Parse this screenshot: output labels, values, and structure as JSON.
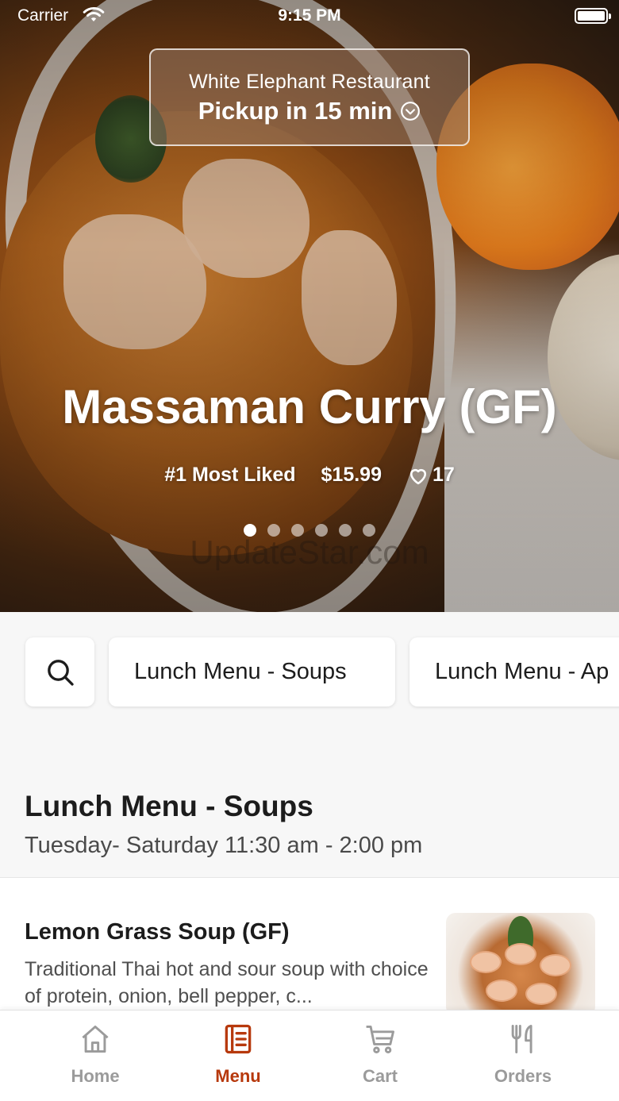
{
  "status_bar": {
    "carrier": "Carrier",
    "time": "9:15 PM"
  },
  "pickup": {
    "restaurant": "White Elephant Restaurant",
    "time_label": "Pickup in 15 min"
  },
  "featured": {
    "title": "Massaman Curry (GF)",
    "rank": "#1 Most Liked",
    "price": "$15.99",
    "likes": "17",
    "carousel_pages": 6,
    "carousel_active": 1,
    "watermark": "UpdateStar.com"
  },
  "categories": [
    "Lunch Menu - Soups",
    "Lunch Menu - Ap"
  ],
  "section": {
    "title": "Lunch Menu - Soups",
    "subtitle": "Tuesday- Saturday 11:30 am - 2:00 pm"
  },
  "items": [
    {
      "name": "Lemon Grass Soup (GF)",
      "description": "Traditional Thai hot and sour soup with choice of protein, onion, bell pepper, c..."
    }
  ],
  "tabs": [
    {
      "label": "Home",
      "icon": "home-icon"
    },
    {
      "label": "Menu",
      "icon": "menu-icon"
    },
    {
      "label": "Cart",
      "icon": "cart-icon"
    },
    {
      "label": "Orders",
      "icon": "utensils-icon"
    }
  ],
  "colors": {
    "accent": "#b7390d",
    "inactive": "#9b9b9b",
    "background": "#f7f7f7"
  }
}
